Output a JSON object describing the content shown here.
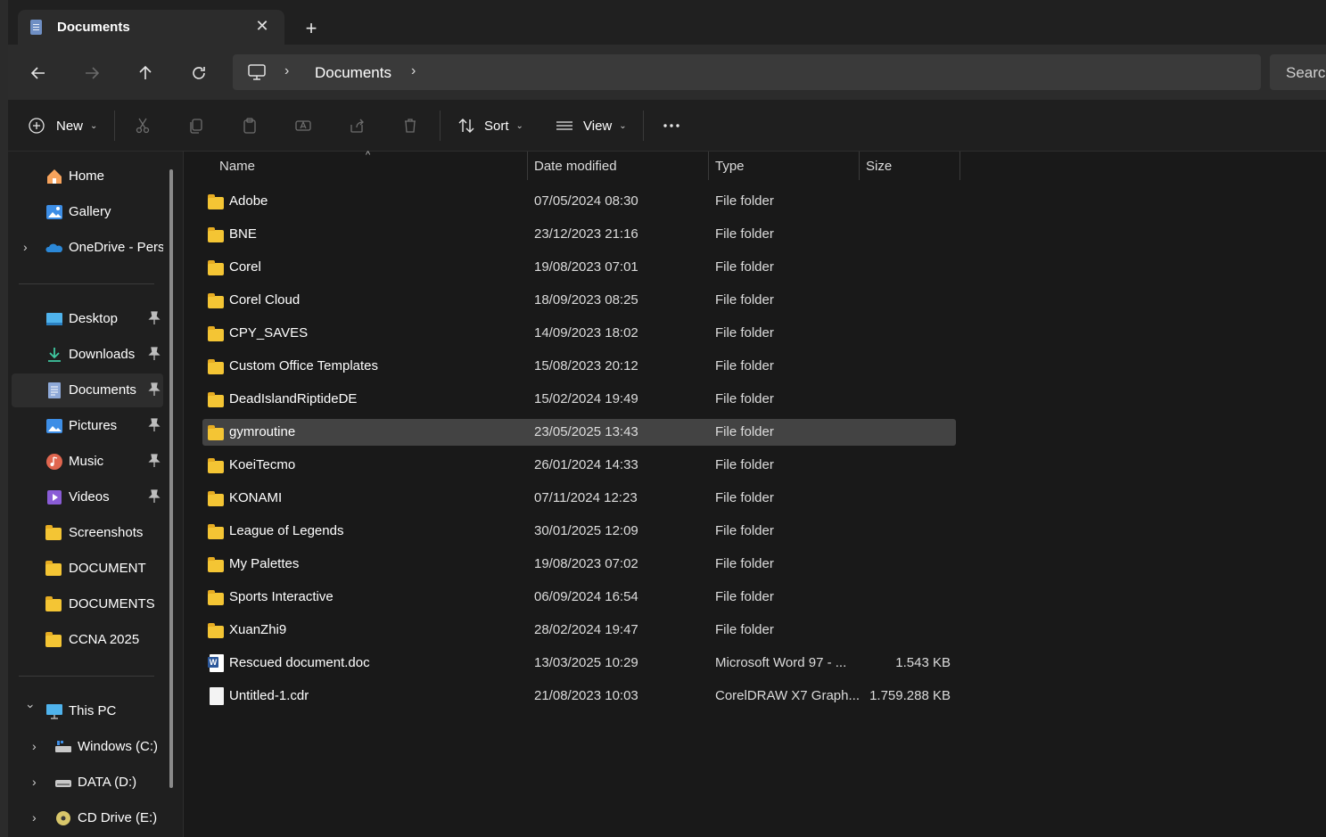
{
  "tab": {
    "title": "Documents"
  },
  "address": {
    "crumbs": [
      "Documents"
    ],
    "search_placeholder": "Search"
  },
  "toolbar": {
    "new_label": "New",
    "sort_label": "Sort",
    "view_label": "View"
  },
  "sidebar": {
    "quick": [
      {
        "label": "Home",
        "icon": "home-icon"
      },
      {
        "label": "Gallery",
        "icon": "gallery-icon"
      },
      {
        "label": "OneDrive - Perso",
        "icon": "onedrive-icon"
      }
    ],
    "pinned": [
      {
        "label": "Desktop",
        "icon": "desktop-icon"
      },
      {
        "label": "Downloads",
        "icon": "download-icon"
      },
      {
        "label": "Documents",
        "icon": "documents-icon"
      },
      {
        "label": "Pictures",
        "icon": "pictures-icon"
      },
      {
        "label": "Music",
        "icon": "music-icon"
      },
      {
        "label": "Videos",
        "icon": "videos-icon"
      },
      {
        "label": "Screenshots",
        "icon": "folder-icon"
      },
      {
        "label": "DOCUMENT",
        "icon": "folder-icon"
      },
      {
        "label": "DOCUMENTS",
        "icon": "folder-icon"
      },
      {
        "label": "CCNA 2025",
        "icon": "folder-icon"
      }
    ],
    "this_pc": {
      "label": "This PC"
    },
    "drives": [
      {
        "label": "Windows (C:)",
        "icon": "drive-c-icon"
      },
      {
        "label": "DATA (D:)",
        "icon": "drive-icon"
      },
      {
        "label": "CD Drive (E:)",
        "icon": "cd-drive-icon"
      }
    ]
  },
  "columns": {
    "name": "Name",
    "date": "Date modified",
    "type": "Type",
    "size": "Size"
  },
  "files": [
    {
      "name": "Adobe",
      "date": "07/05/2024 08:30",
      "type": "File folder",
      "size": ""
    },
    {
      "name": "BNE",
      "date": "23/12/2023 21:16",
      "type": "File folder",
      "size": ""
    },
    {
      "name": "Corel",
      "date": "19/08/2023 07:01",
      "type": "File folder",
      "size": ""
    },
    {
      "name": "Corel Cloud",
      "date": "18/09/2023 08:25",
      "type": "File folder",
      "size": ""
    },
    {
      "name": "CPY_SAVES",
      "date": "14/09/2023 18:02",
      "type": "File folder",
      "size": ""
    },
    {
      "name": "Custom Office Templates",
      "date": "15/08/2023 20:12",
      "type": "File folder",
      "size": ""
    },
    {
      "name": "DeadIslandRiptideDE",
      "date": "15/02/2024 19:49",
      "type": "File folder",
      "size": ""
    },
    {
      "name": "gymroutine",
      "date": "23/05/2025 13:43",
      "type": "File folder",
      "size": ""
    },
    {
      "name": "KoeiTecmo",
      "date": "26/01/2024 14:33",
      "type": "File folder",
      "size": ""
    },
    {
      "name": "KONAMI",
      "date": "07/11/2024 12:23",
      "type": "File folder",
      "size": ""
    },
    {
      "name": "League of Legends",
      "date": "30/01/2025 12:09",
      "type": "File folder",
      "size": ""
    },
    {
      "name": "My Palettes",
      "date": "19/08/2023 07:02",
      "type": "File folder",
      "size": ""
    },
    {
      "name": "Sports Interactive",
      "date": "06/09/2024 16:54",
      "type": "File folder",
      "size": ""
    },
    {
      "name": "XuanZhi9",
      "date": "28/02/2024 19:47",
      "type": "File folder",
      "size": ""
    },
    {
      "name": "Rescued document.doc",
      "date": "13/03/2025 10:29",
      "type": "Microsoft Word 97 - ...",
      "size": "1.543 KB"
    },
    {
      "name": "Untitled-1.cdr",
      "date": "21/08/2023 10:03",
      "type": "CorelDRAW X7 Graph...",
      "size": "1.759.288 KB"
    }
  ],
  "colors": {
    "folder": "#f4c534",
    "selected_row": "#434343",
    "background": "#191919"
  }
}
